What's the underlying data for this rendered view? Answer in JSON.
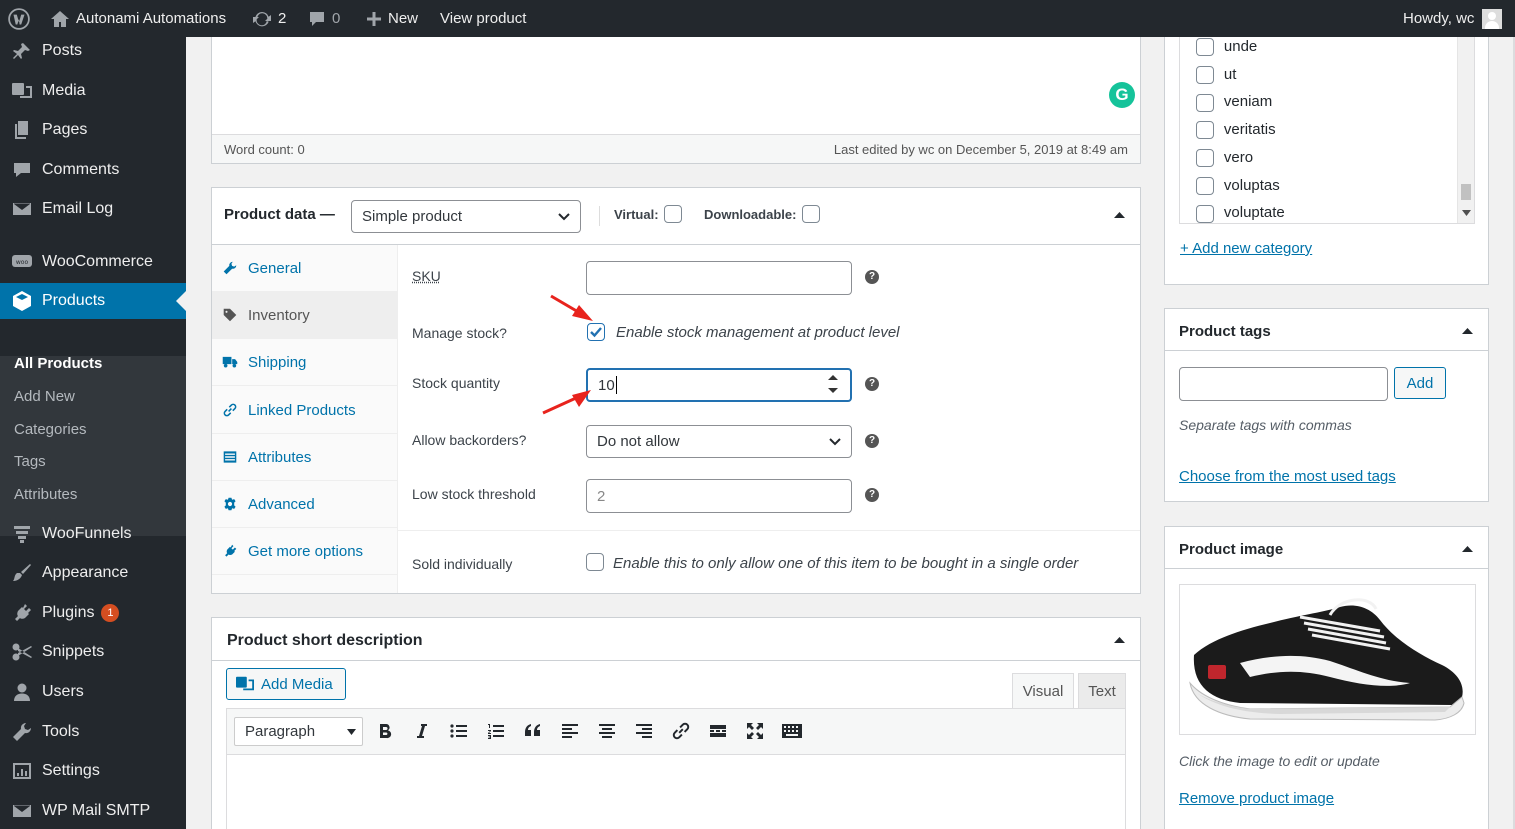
{
  "adminbar": {
    "site_name": "Autonami Automations",
    "updates_count": "2",
    "comments_count": "0",
    "new_label": "New",
    "view_product_label": "View product",
    "howdy": "Howdy, wc"
  },
  "sidebar": {
    "items": [
      {
        "label": "Posts"
      },
      {
        "label": "Media"
      },
      {
        "label": "Pages"
      },
      {
        "label": "Comments"
      },
      {
        "label": "Email Log"
      },
      {
        "label": "WooCommerce"
      },
      {
        "label": "Products"
      },
      {
        "label": "WooFunnels"
      },
      {
        "label": "Appearance"
      },
      {
        "label": "Plugins",
        "badge": "1"
      },
      {
        "label": "Snippets"
      },
      {
        "label": "Users"
      },
      {
        "label": "Tools"
      },
      {
        "label": "Settings"
      },
      {
        "label": "WP Mail SMTP"
      }
    ],
    "submenu": [
      "All Products",
      "Add New",
      "Categories",
      "Tags",
      "Attributes"
    ]
  },
  "editor": {
    "word_count": "Word count: 0",
    "last_edited": "Last edited by wc on December 5, 2019 at 8:49 am",
    "grammarly_letter": "G"
  },
  "product_data": {
    "title": "Product data —",
    "type_value": "Simple product",
    "virtual_label": "Virtual:",
    "downloadable_label": "Downloadable:",
    "tabs": [
      {
        "label": "General"
      },
      {
        "label": "Inventory"
      },
      {
        "label": "Shipping"
      },
      {
        "label": "Linked Products"
      },
      {
        "label": "Attributes"
      },
      {
        "label": "Advanced"
      },
      {
        "label": "Get more options"
      }
    ],
    "sku_label": "SKU",
    "sku_value": "",
    "manage_stock_label": "Manage stock?",
    "manage_stock_text": "Enable stock management at product level",
    "manage_stock_checked": true,
    "stock_qty_label": "Stock quantity",
    "stock_qty_value": "10",
    "backorders_label": "Allow backorders?",
    "backorders_value": "Do not allow",
    "low_stock_label": "Low stock threshold",
    "low_stock_placeholder": "2",
    "sold_individually_label": "Sold individually",
    "sold_individually_text": "Enable this to only allow one of this item to be bought in a single order",
    "help_glyph": "?"
  },
  "short_description": {
    "title": "Product short description",
    "add_media": "Add Media",
    "tab_visual": "Visual",
    "tab_text": "Text",
    "format_value": "Paragraph"
  },
  "categories": {
    "items": [
      "unde",
      "ut",
      "veniam",
      "veritatis",
      "vero",
      "voluptas",
      "voluptate"
    ],
    "add_new": "+ Add new category"
  },
  "tags": {
    "title": "Product tags",
    "add_button": "Add",
    "hint": "Separate tags with commas",
    "choose_link": "Choose from the most used tags"
  },
  "product_image": {
    "title": "Product image",
    "hint": "Click the image to edit or update",
    "remove_link": "Remove product image"
  },
  "colors": {
    "admin_dark": "#23282d",
    "accent": "#0073aa",
    "arrow": "#e8231d"
  }
}
